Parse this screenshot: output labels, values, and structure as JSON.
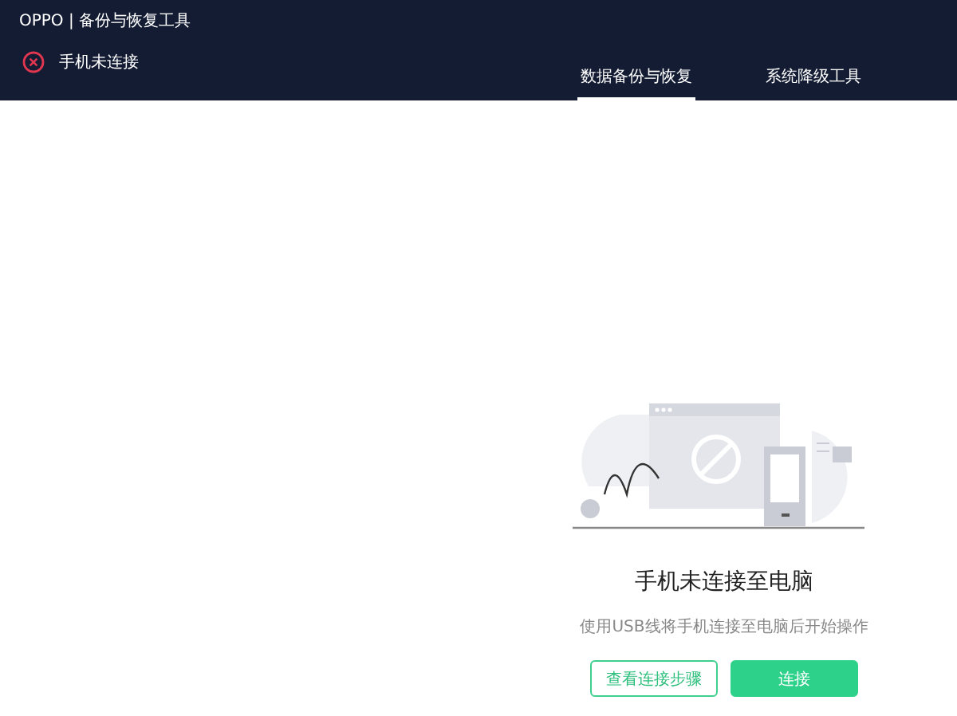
{
  "window": {
    "title": "OPPO | 备份与恢复工具"
  },
  "status": {
    "label": "手机未连接"
  },
  "tabs": [
    {
      "label": "数据备份与恢复",
      "selected": true
    },
    {
      "label": "系统降级工具",
      "selected": false
    }
  ],
  "empty_state": {
    "title": "手机未连接至电脑",
    "message": "使用USB线将手机连接至电脑后开始操作"
  },
  "buttons": [
    {
      "label": "查看连接步骤",
      "kind": "outline"
    },
    {
      "label": "连接",
      "kind": "primary"
    }
  ]
}
